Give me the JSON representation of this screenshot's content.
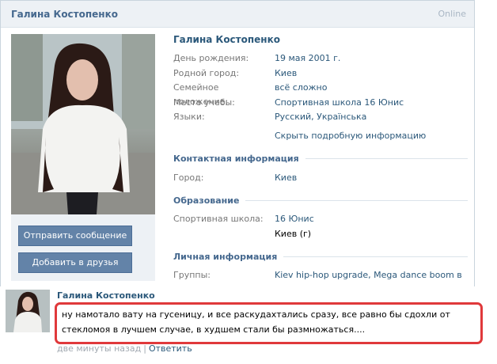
{
  "header": {
    "title": "Галина Костопенко",
    "status": "Online"
  },
  "actions": {
    "send_message": "Отправить сообщение",
    "add_friend": "Добавить в друзья"
  },
  "profile": {
    "name": "Галина Костопенко",
    "fields": [
      {
        "label": "День рождения:",
        "value": "19 мая 2001 г."
      },
      {
        "label": "Родной город:",
        "value": "Киев"
      },
      {
        "label": "Семейное положение:",
        "value": "всё сложно"
      },
      {
        "label": "Место учебы:",
        "value": "Спортивная школа 16 Юнис"
      },
      {
        "label": "Языки:",
        "value": "Русский, Українська"
      }
    ],
    "toggle_details": "Скрыть подробную информацию",
    "contacts": {
      "heading": "Контактная информация",
      "city_label": "Город:",
      "city_value": "Киев"
    },
    "education": {
      "heading": "Образование",
      "school_label": "Спортивная школа:",
      "school_value": "16 Юнис",
      "school_city": "Киев (г)"
    },
    "personal": {
      "heading": "Личная информация",
      "groups_label": "Группы:",
      "groups_value": "Kiev hip-hop upgrade, Mega dance boom в"
    }
  },
  "comment": {
    "author": "Галина Костопенко",
    "text": "ну намотало вату на гусеницу, и все раскудахтались сразу, все равно бы сдохли от стекломоя в лучшем случае, в худшем стали бы размножаться....",
    "time": "две минуты назад",
    "separator": "|",
    "reply": "Ответить"
  },
  "colors": {
    "link": "#2b587a",
    "button": "#6383a8",
    "highlight_border": "#e0393b"
  }
}
